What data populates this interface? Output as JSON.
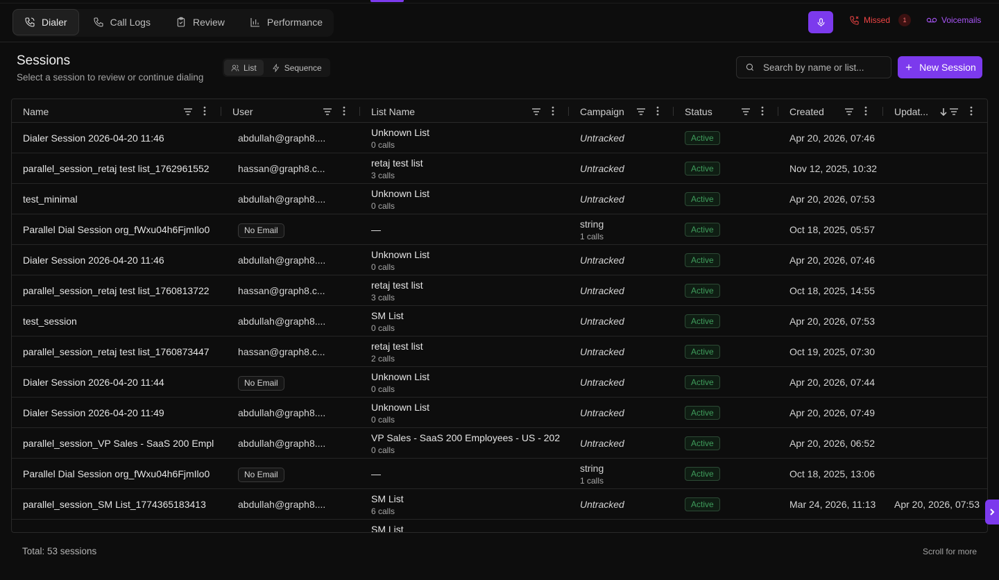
{
  "nav": {
    "tabs": [
      {
        "label": "Dialer",
        "icon": "phone-icon",
        "active": true
      },
      {
        "label": "Call Logs",
        "icon": "phone-icon",
        "active": false
      },
      {
        "label": "Review",
        "icon": "clipboard-check-icon",
        "active": false
      },
      {
        "label": "Performance",
        "icon": "bar-chart-icon",
        "active": false
      }
    ],
    "missed_label": "Missed",
    "missed_count": "1",
    "voicemails_label": "Voicemails"
  },
  "sessions": {
    "title": "Sessions",
    "subtitle": "Select a session to review or continue dialing",
    "view_list": "List",
    "view_sequence": "Sequence",
    "search_placeholder": "Search by name or list...",
    "new_session_label": "New Session"
  },
  "table": {
    "columns": [
      "Name",
      "User",
      "List Name",
      "Campaign",
      "Status",
      "Created",
      "Updat..."
    ],
    "rows": [
      {
        "name": "Dialer Session 2026-04-20 11:46",
        "user": "abdullah@graph8....",
        "list": "Unknown List",
        "calls": "0 calls",
        "campaign": "Untracked",
        "campaign_calls": "",
        "status": "Active",
        "created": "Apr 20, 2026, 07:46",
        "updated": ""
      },
      {
        "name": "parallel_session_retaj test list_1762961552",
        "user": "hassan@graph8.c...",
        "list": "retaj test list",
        "calls": "3 calls",
        "campaign": "Untracked",
        "campaign_calls": "",
        "status": "Active",
        "created": "Nov 12, 2025, 10:32",
        "updated": ""
      },
      {
        "name": "test_minimal",
        "user": "abdullah@graph8....",
        "list": "Unknown List",
        "calls": "0 calls",
        "campaign": "Untracked",
        "campaign_calls": "",
        "status": "Active",
        "created": "Apr 20, 2026, 07:53",
        "updated": ""
      },
      {
        "name": "Parallel Dial Session org_fWxu04h6FjmIlo0",
        "user": "No Email",
        "list": "—",
        "calls": "",
        "campaign": "string",
        "campaign_calls": "1 calls",
        "status": "Active",
        "created": "Oct 18, 2025, 05:57",
        "updated": ""
      },
      {
        "name": "Dialer Session 2026-04-20 11:46",
        "user": "abdullah@graph8....",
        "list": "Unknown List",
        "calls": "0 calls",
        "campaign": "Untracked",
        "campaign_calls": "",
        "status": "Active",
        "created": "Apr 20, 2026, 07:46",
        "updated": ""
      },
      {
        "name": "parallel_session_retaj test list_1760813722",
        "user": "hassan@graph8.c...",
        "list": "retaj test list",
        "calls": "3 calls",
        "campaign": "Untracked",
        "campaign_calls": "",
        "status": "Active",
        "created": "Oct 18, 2025, 14:55",
        "updated": ""
      },
      {
        "name": "test_session",
        "user": "abdullah@graph8....",
        "list": "SM List",
        "calls": "0 calls",
        "campaign": "Untracked",
        "campaign_calls": "",
        "status": "Active",
        "created": "Apr 20, 2026, 07:53",
        "updated": ""
      },
      {
        "name": "parallel_session_retaj test list_1760873447",
        "user": "hassan@graph8.c...",
        "list": "retaj test list",
        "calls": "2 calls",
        "campaign": "Untracked",
        "campaign_calls": "",
        "status": "Active",
        "created": "Oct 19, 2025, 07:30",
        "updated": ""
      },
      {
        "name": "Dialer Session 2026-04-20 11:44",
        "user": "No Email",
        "list": "Unknown List",
        "calls": "0 calls",
        "campaign": "Untracked",
        "campaign_calls": "",
        "status": "Active",
        "created": "Apr 20, 2026, 07:44",
        "updated": ""
      },
      {
        "name": "Dialer Session 2026-04-20 11:49",
        "user": "abdullah@graph8....",
        "list": "Unknown List",
        "calls": "0 calls",
        "campaign": "Untracked",
        "campaign_calls": "",
        "status": "Active",
        "created": "Apr 20, 2026, 07:49",
        "updated": ""
      },
      {
        "name": "parallel_session_VP Sales - SaaS 200 Empl",
        "user": "abdullah@graph8....",
        "list": "VP Sales - SaaS 200 Employees - US - 202",
        "calls": "0 calls",
        "campaign": "Untracked",
        "campaign_calls": "",
        "status": "Active",
        "created": "Apr 20, 2026, 06:52",
        "updated": ""
      },
      {
        "name": "Parallel Dial Session org_fWxu04h6FjmIlo0",
        "user": "No Email",
        "list": "—",
        "calls": "",
        "campaign": "string",
        "campaign_calls": "1 calls",
        "status": "Active",
        "created": "Oct 18, 2025, 13:06",
        "updated": ""
      },
      {
        "name": "parallel_session_SM List_1774365183413",
        "user": "abdullah@graph8....",
        "list": "SM List",
        "calls": "6 calls",
        "campaign": "Untracked",
        "campaign_calls": "",
        "status": "Active",
        "created": "Mar 24, 2026, 11:13",
        "updated": "Apr 20, 2026, 07:53"
      },
      {
        "name": "",
        "user": "",
        "list": "SM List",
        "calls": "",
        "campaign": "",
        "campaign_calls": "",
        "status": "",
        "created": "",
        "updated": ""
      }
    ]
  },
  "footer": {
    "total": "Total: 53 sessions",
    "scroll_hint": "Scroll for more"
  },
  "colors": {
    "accent": "#7c3aed",
    "missed": "#ef4444",
    "active_badge": "#3f9d5c"
  }
}
